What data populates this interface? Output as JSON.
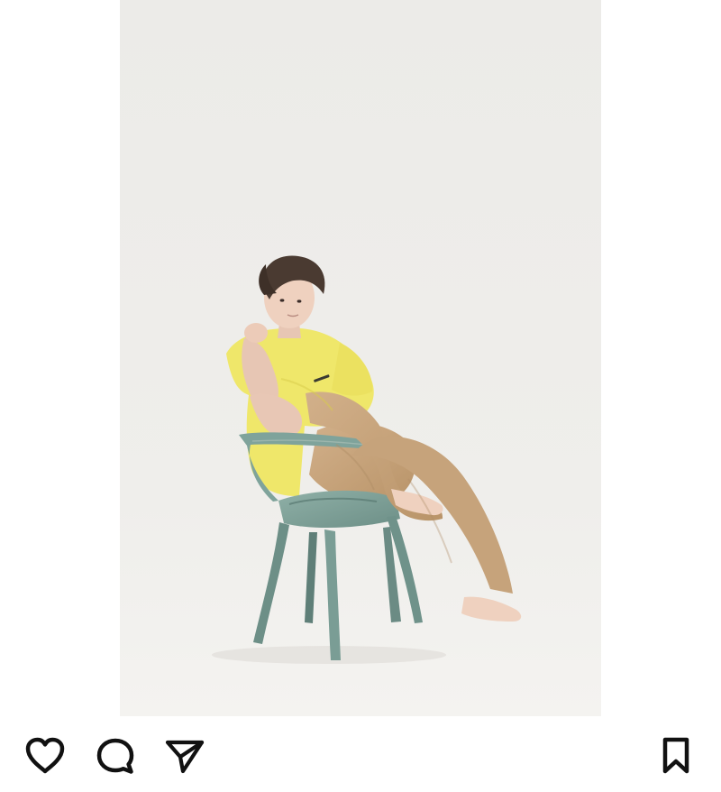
{
  "post": {
    "photo": {
      "subject": "photo-portrait"
    }
  },
  "actions": {
    "like_icon": "heart-icon",
    "comment_icon": "comment-icon",
    "share_icon": "send-icon",
    "save_icon": "bookmark-icon"
  },
  "colors": {
    "icon": "#111111",
    "photo_bg": "#efeeeb",
    "shirt": "#efe76a",
    "pants": "#c8a57f",
    "chair": "#7fa39b",
    "hair": "#4a3a31",
    "skin": "#efd1bf"
  }
}
